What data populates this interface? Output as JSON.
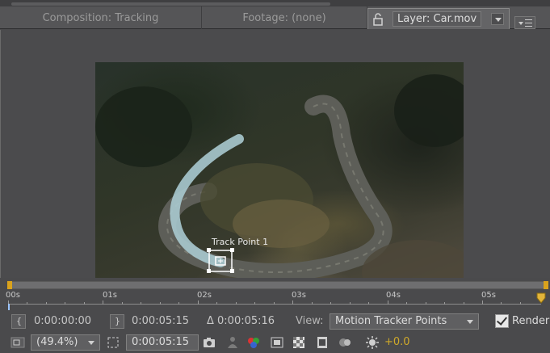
{
  "tabs": {
    "composition": "Composition: Tracking",
    "footage": "Footage: (none)",
    "layer": "Layer: Car.mov"
  },
  "viewer": {
    "track_point_label": "Track Point 1"
  },
  "timeline": {
    "ruler_labels": [
      "00s",
      "01s",
      "02s",
      "03s",
      "04s",
      "05s"
    ]
  },
  "controls": {
    "in_point": "0:00:00:00",
    "out_point": "0:00:05:15",
    "duration": "Δ 0:00:05:16",
    "view_label": "View:",
    "view_value": "Motion Tracker Points",
    "render_label": "Render",
    "render_checked": true,
    "zoom": "(49.4%)",
    "current_time": "0:00:05:15",
    "exposure": "+0.0"
  },
  "colors": {
    "accent_yellow": "#d9a21c",
    "track_path": "#a9c9cf"
  }
}
